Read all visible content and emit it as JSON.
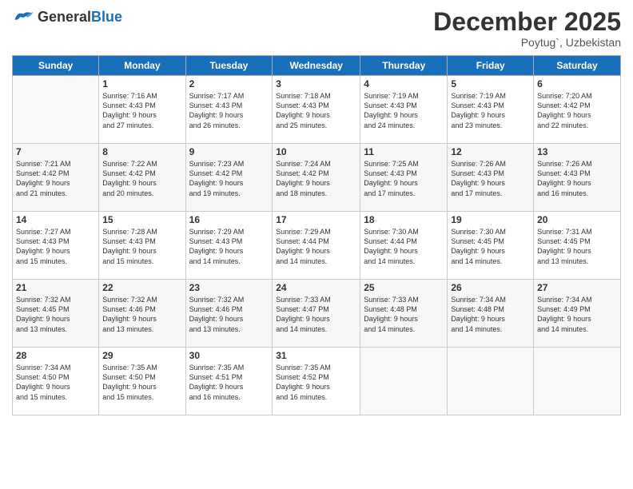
{
  "header": {
    "logo_general": "General",
    "logo_blue": "Blue",
    "month_title": "December 2025",
    "subtitle": "Poytug`, Uzbekistan"
  },
  "days_of_week": [
    "Sunday",
    "Monday",
    "Tuesday",
    "Wednesday",
    "Thursday",
    "Friday",
    "Saturday"
  ],
  "weeks": [
    [
      {
        "day": "",
        "info": ""
      },
      {
        "day": "1",
        "info": "Sunrise: 7:16 AM\nSunset: 4:43 PM\nDaylight: 9 hours\nand 27 minutes."
      },
      {
        "day": "2",
        "info": "Sunrise: 7:17 AM\nSunset: 4:43 PM\nDaylight: 9 hours\nand 26 minutes."
      },
      {
        "day": "3",
        "info": "Sunrise: 7:18 AM\nSunset: 4:43 PM\nDaylight: 9 hours\nand 25 minutes."
      },
      {
        "day": "4",
        "info": "Sunrise: 7:19 AM\nSunset: 4:43 PM\nDaylight: 9 hours\nand 24 minutes."
      },
      {
        "day": "5",
        "info": "Sunrise: 7:19 AM\nSunset: 4:43 PM\nDaylight: 9 hours\nand 23 minutes."
      },
      {
        "day": "6",
        "info": "Sunrise: 7:20 AM\nSunset: 4:42 PM\nDaylight: 9 hours\nand 22 minutes."
      }
    ],
    [
      {
        "day": "7",
        "info": "Sunrise: 7:21 AM\nSunset: 4:42 PM\nDaylight: 9 hours\nand 21 minutes."
      },
      {
        "day": "8",
        "info": "Sunrise: 7:22 AM\nSunset: 4:42 PM\nDaylight: 9 hours\nand 20 minutes."
      },
      {
        "day": "9",
        "info": "Sunrise: 7:23 AM\nSunset: 4:42 PM\nDaylight: 9 hours\nand 19 minutes."
      },
      {
        "day": "10",
        "info": "Sunrise: 7:24 AM\nSunset: 4:42 PM\nDaylight: 9 hours\nand 18 minutes."
      },
      {
        "day": "11",
        "info": "Sunrise: 7:25 AM\nSunset: 4:43 PM\nDaylight: 9 hours\nand 17 minutes."
      },
      {
        "day": "12",
        "info": "Sunrise: 7:26 AM\nSunset: 4:43 PM\nDaylight: 9 hours\nand 17 minutes."
      },
      {
        "day": "13",
        "info": "Sunrise: 7:26 AM\nSunset: 4:43 PM\nDaylight: 9 hours\nand 16 minutes."
      }
    ],
    [
      {
        "day": "14",
        "info": "Sunrise: 7:27 AM\nSunset: 4:43 PM\nDaylight: 9 hours\nand 15 minutes."
      },
      {
        "day": "15",
        "info": "Sunrise: 7:28 AM\nSunset: 4:43 PM\nDaylight: 9 hours\nand 15 minutes."
      },
      {
        "day": "16",
        "info": "Sunrise: 7:29 AM\nSunset: 4:43 PM\nDaylight: 9 hours\nand 14 minutes."
      },
      {
        "day": "17",
        "info": "Sunrise: 7:29 AM\nSunset: 4:44 PM\nDaylight: 9 hours\nand 14 minutes."
      },
      {
        "day": "18",
        "info": "Sunrise: 7:30 AM\nSunset: 4:44 PM\nDaylight: 9 hours\nand 14 minutes."
      },
      {
        "day": "19",
        "info": "Sunrise: 7:30 AM\nSunset: 4:45 PM\nDaylight: 9 hours\nand 14 minutes."
      },
      {
        "day": "20",
        "info": "Sunrise: 7:31 AM\nSunset: 4:45 PM\nDaylight: 9 hours\nand 13 minutes."
      }
    ],
    [
      {
        "day": "21",
        "info": "Sunrise: 7:32 AM\nSunset: 4:45 PM\nDaylight: 9 hours\nand 13 minutes."
      },
      {
        "day": "22",
        "info": "Sunrise: 7:32 AM\nSunset: 4:46 PM\nDaylight: 9 hours\nand 13 minutes."
      },
      {
        "day": "23",
        "info": "Sunrise: 7:32 AM\nSunset: 4:46 PM\nDaylight: 9 hours\nand 13 minutes."
      },
      {
        "day": "24",
        "info": "Sunrise: 7:33 AM\nSunset: 4:47 PM\nDaylight: 9 hours\nand 14 minutes."
      },
      {
        "day": "25",
        "info": "Sunrise: 7:33 AM\nSunset: 4:48 PM\nDaylight: 9 hours\nand 14 minutes."
      },
      {
        "day": "26",
        "info": "Sunrise: 7:34 AM\nSunset: 4:48 PM\nDaylight: 9 hours\nand 14 minutes."
      },
      {
        "day": "27",
        "info": "Sunrise: 7:34 AM\nSunset: 4:49 PM\nDaylight: 9 hours\nand 14 minutes."
      }
    ],
    [
      {
        "day": "28",
        "info": "Sunrise: 7:34 AM\nSunset: 4:50 PM\nDaylight: 9 hours\nand 15 minutes."
      },
      {
        "day": "29",
        "info": "Sunrise: 7:35 AM\nSunset: 4:50 PM\nDaylight: 9 hours\nand 15 minutes."
      },
      {
        "day": "30",
        "info": "Sunrise: 7:35 AM\nSunset: 4:51 PM\nDaylight: 9 hours\nand 16 minutes."
      },
      {
        "day": "31",
        "info": "Sunrise: 7:35 AM\nSunset: 4:52 PM\nDaylight: 9 hours\nand 16 minutes."
      },
      {
        "day": "",
        "info": ""
      },
      {
        "day": "",
        "info": ""
      },
      {
        "day": "",
        "info": ""
      }
    ]
  ]
}
